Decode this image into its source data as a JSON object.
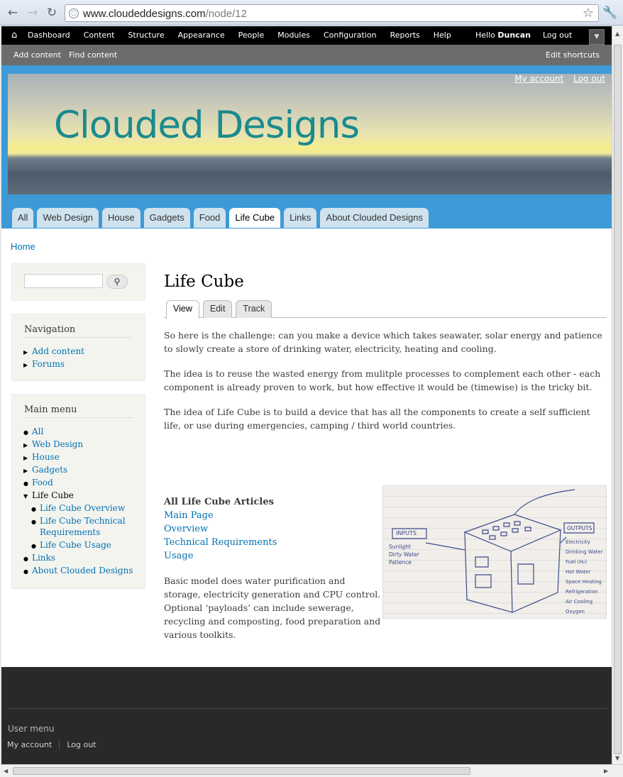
{
  "browser": {
    "url_domain": "www.cloudeddesigns.com",
    "url_path": "/node/12"
  },
  "toolbar": {
    "items": [
      "Dashboard",
      "Content",
      "Structure",
      "Appearance",
      "People",
      "Modules",
      "Configuration",
      "Reports",
      "Help"
    ],
    "hello": "Hello",
    "user": "Duncan",
    "logout": "Log out"
  },
  "shortcuts": {
    "add_content": "Add content",
    "find_content": "Find content",
    "edit_shortcuts": "Edit shortcuts"
  },
  "header": {
    "site_name": "Clouded Designs",
    "my_account": "My account",
    "log_out": "Log out"
  },
  "main_tabs": [
    "All",
    "Web Design",
    "House",
    "Gadgets",
    "Food",
    "Life Cube",
    "Links",
    "About Clouded Designs"
  ],
  "active_tab": "Life Cube",
  "breadcrumb": "Home",
  "sidebar": {
    "navigation_title": "Navigation",
    "navigation_items": [
      "Add content",
      "Forums"
    ],
    "main_menu_title": "Main menu",
    "main_menu_items": [
      "All",
      "Web Design",
      "House",
      "Gadgets",
      "Food",
      "Life Cube",
      "Life Cube Overview",
      "Life Cube Technical Requirements",
      "Life Cube Usage",
      "Links",
      "About Clouded Designs"
    ]
  },
  "node": {
    "title": "Life Cube",
    "local_tabs": [
      "View",
      "Edit",
      "Track"
    ],
    "paragraphs": [
      "So here is the challenge: can you make a device which takes seawater, solar energy and patience to slowly create a store of drinking water, electricity, heating and cooling.",
      "The idea is to reuse the wasted energy from mulitple processes to complement each other - each component is already proven to work, but how effective it would be (timewise) is the tricky bit.",
      "The idea of Life Cube is to build a device that has all the components to create a self sufficient life, or use during emergencies, camping / third world countries."
    ],
    "articles_heading": "All Life Cube Articles",
    "articles": [
      "Main Page",
      "Overview",
      "Technical Requirements",
      "Usage"
    ],
    "description": "Basic model does water purification and storage, electricity generation and CPU control. Optional ‘payloads’ can include sewerage, recycling and composting, food preparation and various toolkits."
  },
  "sketch": {
    "inputs_label": "INPUTS",
    "inputs": [
      "Sunlight",
      "Dirty Water",
      "Patience"
    ],
    "outputs_label": "OUTPUTS",
    "outputs": [
      "Electricity",
      "Drinking Water",
      "Fuel (H₂)",
      "Hot Water",
      "Space Heating",
      "Refrigeration",
      "Air Cooling",
      "Oxygen"
    ]
  },
  "footer": {
    "title": "User menu",
    "my_account": "My account",
    "log_out": "Log out"
  }
}
